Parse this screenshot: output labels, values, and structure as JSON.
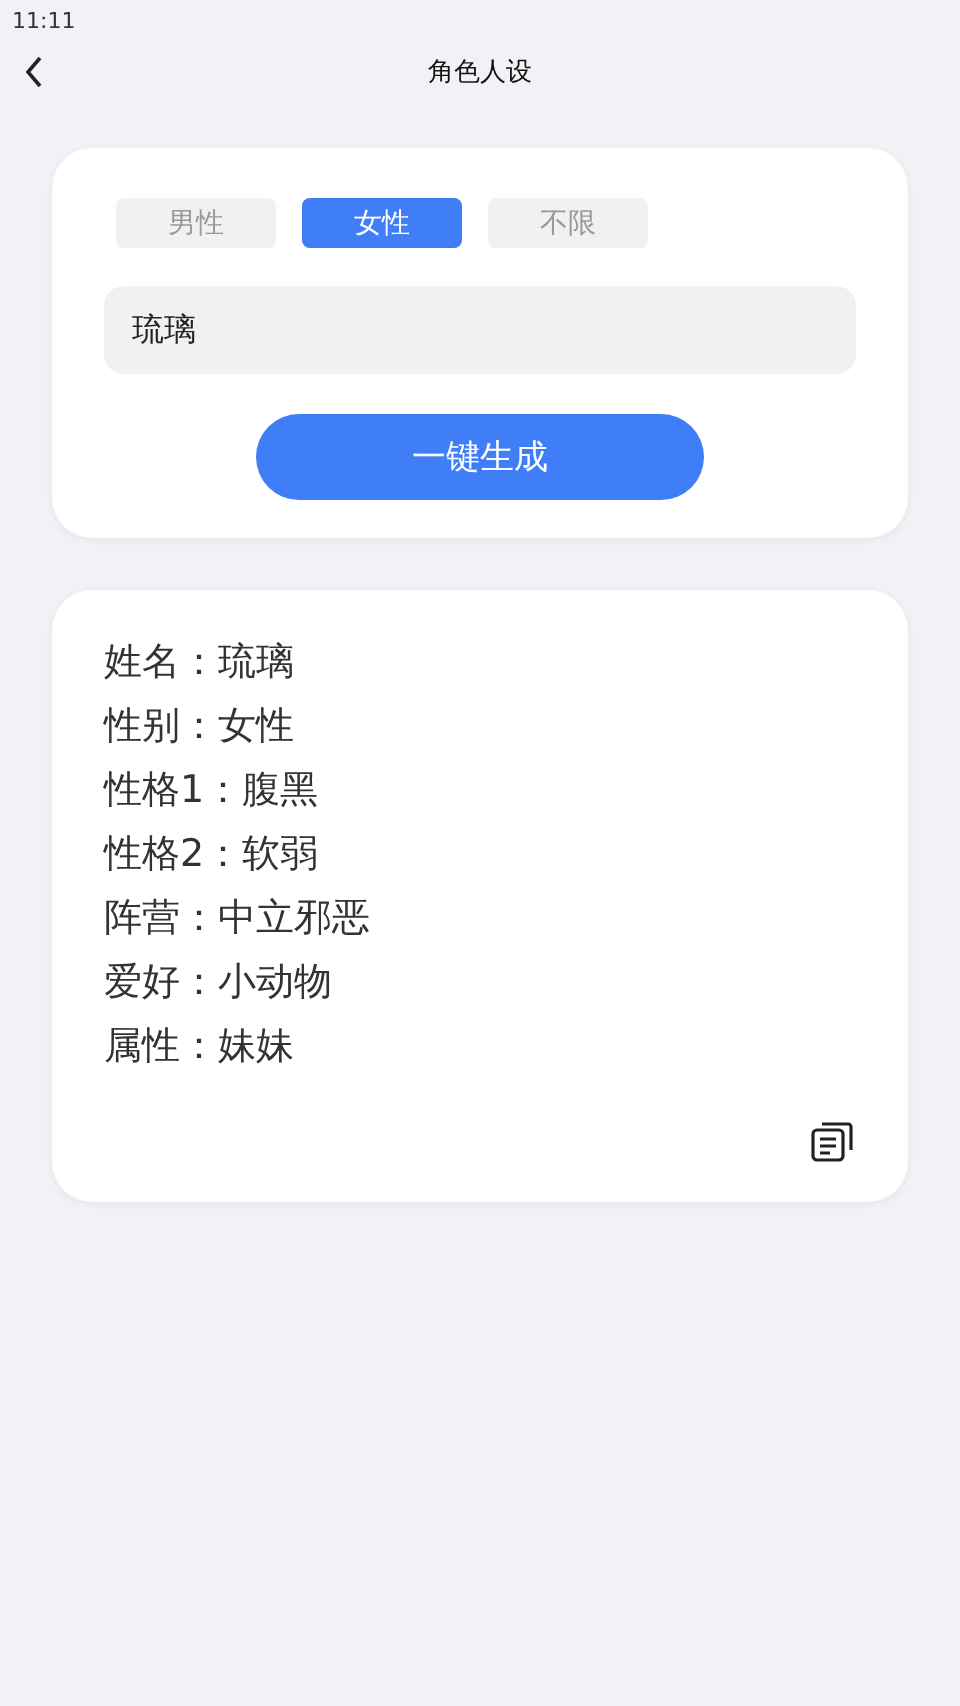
{
  "status_bar": {
    "time": "11:11"
  },
  "header": {
    "title": "角色人设"
  },
  "gender_tabs": [
    {
      "label": "男性",
      "selected": false
    },
    {
      "label": "女性",
      "selected": true
    },
    {
      "label": "不限",
      "selected": false
    }
  ],
  "name_field": {
    "value": "琉璃"
  },
  "generate_button": "一键生成",
  "result": {
    "lines": [
      "姓名：琉璃",
      "性别：女性",
      "性格1：腹黑",
      "性格2：软弱",
      "阵营：中立邪恶",
      "爱好：小动物",
      "属性：妹妹"
    ]
  }
}
